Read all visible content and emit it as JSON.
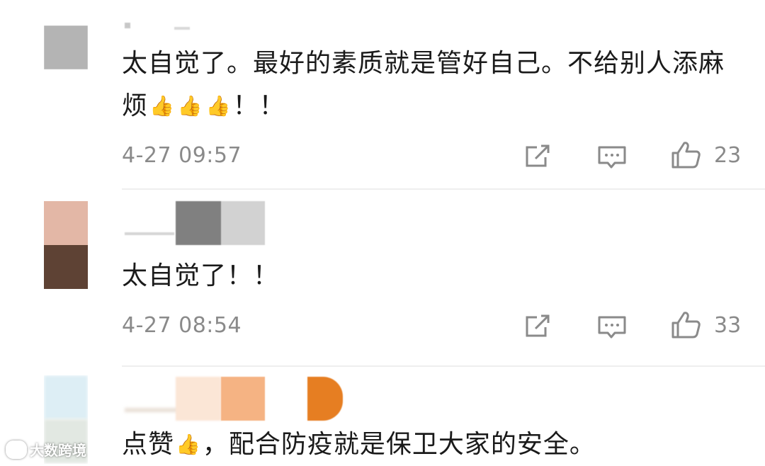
{
  "comments": [
    {
      "text": "太自觉了。最好的素质就是管好自己。不给别人添麻烦",
      "emoji": [
        "👍",
        "👍",
        "👍"
      ],
      "suffix": "！！",
      "time": "4-27 09:57",
      "likes": "23"
    },
    {
      "text": "太自觉了！！",
      "time": "4-27 08:54",
      "likes": "33"
    },
    {
      "text_before": "点赞",
      "emoji": "👍",
      "text_after": "，配合防疫就是保卫大家的安全。"
    }
  ],
  "icons": {
    "share": "share-icon",
    "comment": "comment-icon",
    "like": "thumbs-up-icon"
  },
  "watermark": "大数跨境",
  "colors": {
    "text": "#1a1a1a",
    "meta": "#8a8a8a",
    "divider": "#eeeeee"
  }
}
